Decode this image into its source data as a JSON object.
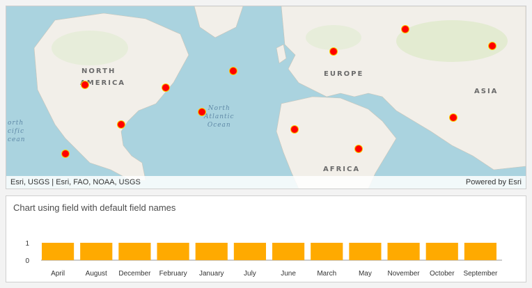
{
  "map": {
    "attribution": "Esri, USGS | Esri, FAO, NOAA, USGS",
    "powered_by": "Powered by Esri",
    "labels": {
      "north_america": [
        "NORTH",
        "AMERICA"
      ],
      "europe": "EUROPE",
      "asia": "ASIA",
      "africa": "AFRICA",
      "north_atlantic": "North\nAtlantic\nOcean",
      "north_pacific": "orth\ncific\ncean"
    },
    "marker_color": "#ff0000",
    "marker_outline": "#f6d000"
  },
  "chart": {
    "title": "Chart using field with default field names",
    "bar_color": "#ffaa00"
  },
  "chart_data": {
    "type": "bar",
    "title": "Chart using field with default field names",
    "categories": [
      "April",
      "August",
      "December",
      "February",
      "January",
      "July",
      "June",
      "March",
      "May",
      "November",
      "October",
      "September"
    ],
    "values": [
      1,
      1,
      1,
      1,
      1,
      1,
      1,
      1,
      1,
      1,
      1,
      1
    ],
    "ylim": [
      0,
      1
    ],
    "yticks": [
      "1",
      "0"
    ]
  }
}
